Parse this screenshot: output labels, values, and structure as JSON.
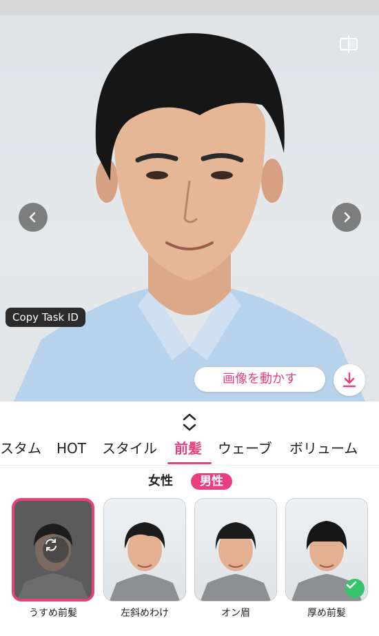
{
  "photo": {
    "copy_task_label": "Copy Task ID",
    "move_image_label": "画像を動かす",
    "icons": {
      "compare": "compare-split-icon",
      "prev": "chevron-left-icon",
      "next": "chevron-right-icon",
      "download": "download-icon"
    }
  },
  "sheet": {
    "toggle_icon": "expand-collapse-icon",
    "tabs": [
      {
        "label": "スタム",
        "active": false
      },
      {
        "label": "HOT",
        "active": false
      },
      {
        "label": "スタイル",
        "active": false
      },
      {
        "label": "前髪",
        "active": true
      },
      {
        "label": "ウェーブ",
        "active": false
      },
      {
        "label": "ボリューム",
        "active": false
      }
    ],
    "gender": {
      "female": "女性",
      "male": "男性",
      "selected": "男性"
    },
    "styles": [
      {
        "label": "うすめ前髪",
        "selected": true,
        "icon": "refresh-icon"
      },
      {
        "label": "左斜めわけ",
        "selected": false
      },
      {
        "label": "オン眉",
        "selected": false
      },
      {
        "label": "厚め前髪",
        "selected": false,
        "applied": true,
        "icon": "check-icon"
      }
    ]
  },
  "colors": {
    "accent": "#e83f7f",
    "check": "#35c46a"
  }
}
